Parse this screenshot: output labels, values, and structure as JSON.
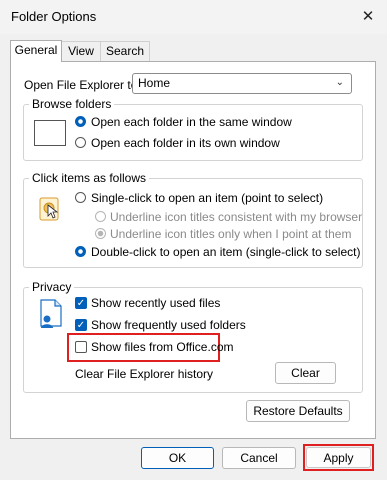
{
  "window": {
    "title": "Folder Options"
  },
  "tabs": [
    {
      "label": "General"
    },
    {
      "label": "View"
    },
    {
      "label": "Search"
    }
  ],
  "open_explorer": {
    "label": "Open File Explorer to:",
    "value": "Home"
  },
  "browse": {
    "title": "Browse folders",
    "options": [
      {
        "label": "Open each folder in the same window",
        "checked": true
      },
      {
        "label": "Open each folder in its own window",
        "checked": false
      }
    ]
  },
  "click": {
    "title": "Click items as follows",
    "single": "Single-click to open an item (point to select)",
    "sub1": "Underline icon titles consistent with my browser",
    "sub2": "Underline icon titles only when I point at them",
    "double": "Double-click to open an item (single-click to select)"
  },
  "privacy": {
    "title": "Privacy",
    "recent_files": "Show recently used files",
    "frequent_folders": "Show frequently used folders",
    "office": "Show files from Office.com",
    "clear_label": "Clear File Explorer history",
    "clear_button": "Clear"
  },
  "restore_button": "Restore Defaults",
  "footer": {
    "ok": "OK",
    "cancel": "Cancel",
    "apply": "Apply"
  },
  "colors": {
    "accent": "#005fb8",
    "highlight": "#e02020"
  }
}
